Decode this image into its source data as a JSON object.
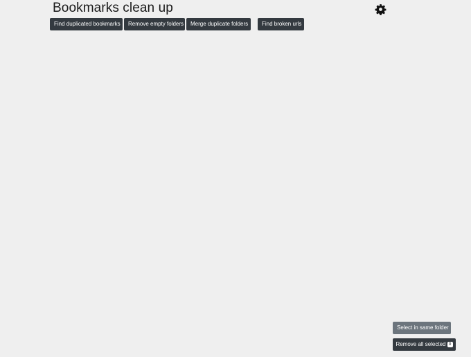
{
  "header": {
    "title": "Bookmarks clean up",
    "settings_icon": "gear-icon"
  },
  "toolbar": {
    "find_duplicated_label": "Find duplicated bookmarks",
    "remove_empty_label": "Remove empty folders",
    "merge_duplicate_label": "Merge duplicate folders",
    "find_broken_label": "Find broken urls"
  },
  "footer": {
    "select_same_folder_label": "Select in same folder",
    "remove_all_selected_label": "Remove all selected",
    "selected_count": "0"
  },
  "colors": {
    "background": "#efefef",
    "button_dark": "#343a40",
    "button_secondary": "#6c757d"
  }
}
